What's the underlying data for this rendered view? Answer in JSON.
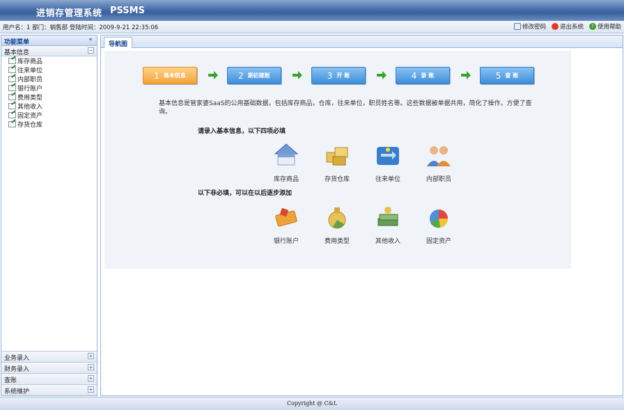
{
  "titlebar": {
    "app_title": "进销存管理系统",
    "brand": "PSSMS"
  },
  "infobar": {
    "user_info": "用户名：1  部门：销售部  登陆时间：2009-9-21 22:35:06",
    "actions": {
      "change_password": "修改密码",
      "logout": "退出系统",
      "help": "使用帮助"
    }
  },
  "sidebar": {
    "title": "功能菜单",
    "collapse_glyph": "«",
    "active_group": "基本信息",
    "items": [
      "库存商品",
      "往来单位",
      "内部职员",
      "银行账户",
      "费用类型",
      "其他收入",
      "固定资产",
      "存货仓库"
    ],
    "other_groups": [
      "业务录入",
      "财务录入",
      "查账",
      "系统维护"
    ]
  },
  "main": {
    "tab": "导航图",
    "steps": [
      {
        "num": "1",
        "label": "基本信息",
        "color": "#f4a23a"
      },
      {
        "num": "2",
        "label": "期初建账",
        "color": "#3d8ed8"
      },
      {
        "num": "3",
        "label": "开 账",
        "color": "#3d8ed8"
      },
      {
        "num": "4",
        "label": "录 账",
        "color": "#3d8ed8"
      },
      {
        "num": "5",
        "label": "查 账",
        "color": "#3d8ed8"
      }
    ],
    "description": "基本信息是管家婆SaaS的公用基础数据，包括库存商品，仓库，往来单位，职员姓名等。这些数据被单据共用，简化了操作，方便了查询。",
    "required_heading": "请录入基本信息，以下四项必填",
    "required_tiles": [
      "库存商品",
      "存货仓库",
      "往来单位",
      "内部职员"
    ],
    "optional_heading": "以下非必填，可以在以后逐步添加",
    "optional_tiles": [
      "银行账户",
      "费用类型",
      "其他收入",
      "固定资产"
    ]
  },
  "footer": {
    "copyright": "Copyright @ C&L"
  },
  "colors": {
    "accent_blue": "#3d8ed8",
    "step_orange": "#f4a23a",
    "arrow_green": "#3aa12e",
    "title_bar": "#4f75ae"
  }
}
